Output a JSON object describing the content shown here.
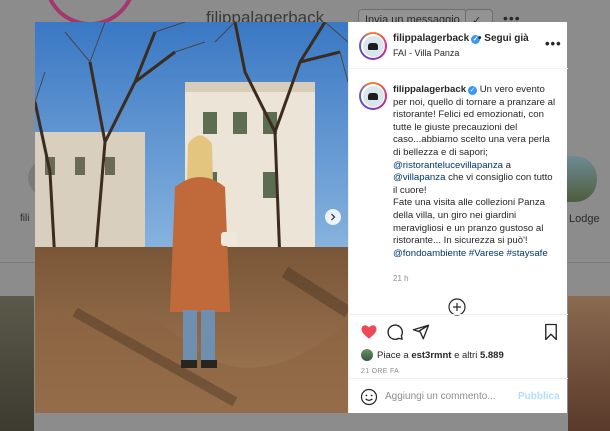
{
  "background": {
    "username": "filippalagerback",
    "message_button": "Invia un messaggio",
    "highlight_left_label": "fili",
    "highlight_right_label": "Lodge"
  },
  "post": {
    "username": "filippalagerback",
    "follow_label": "• Segui già",
    "location": "FAI - Villa Panza",
    "caption": {
      "intro": "Un vero evento per noi, quello di tornare a pranzare al ristorante! Felici ed emozionati, con tutte le giuste precauzioni del caso...abbiamo scelto una vera perla di bellezza e di sapori;",
      "mention1": "@ristorantelucevillapanza",
      "joiner": " a ",
      "mention2": "@villapanza",
      "after_mentions": " che vi consiglio con tutto il cuore!",
      "body2": "Fate una visita alle collezioni Panza della villa, un giro nei giardini meravigliosi e un pranzo gustoso al ristorante... In sicurezza si può'!",
      "mention3": "@fondoambiente",
      "tag1": "#Varese",
      "tag2": "#staysafe"
    },
    "caption_time": "21 h",
    "likes_text_prefix": "Piace a ",
    "likes_user": "est3rmnt",
    "likes_text_mid": " e altri ",
    "likes_count": "5.889",
    "post_time": "21 ORE FA",
    "comment_placeholder": "Aggiungi un commento...",
    "publish_label": "Pubblica"
  },
  "colors": {
    "like_heart": "#ed4956",
    "link": "#00376b",
    "verified": "#3897f0"
  }
}
